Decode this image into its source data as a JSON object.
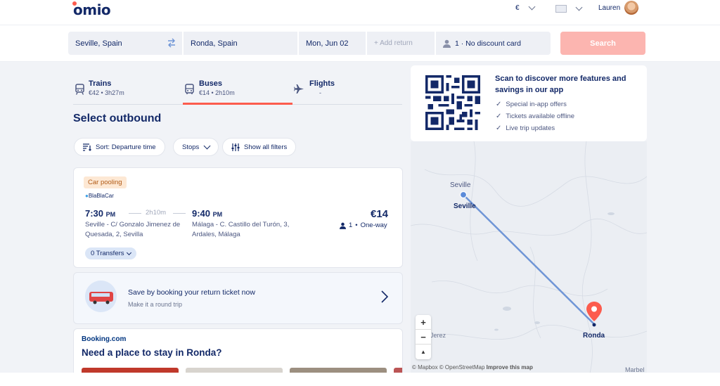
{
  "header": {
    "logo": "omio",
    "currency": "€",
    "user_name": "Lauren"
  },
  "search": {
    "origin": "Seville, Spain",
    "destination": "Ronda, Spain",
    "depart_date": "Mon, Jun 02",
    "return_placeholder": "+ Add return",
    "passengers": "1 · No discount card",
    "search_label": "Search"
  },
  "tabs": [
    {
      "label": "Trains",
      "sub": "€42 • 3h27m"
    },
    {
      "label": "Buses",
      "sub": "€14 • 2h10m"
    },
    {
      "label": "Flights",
      "sub": "-"
    }
  ],
  "heading": "Select outbound",
  "filters": {
    "sort": "Sort: Departure time",
    "stops": "Stops",
    "all": "Show all filters"
  },
  "result": {
    "badge": "Car pooling",
    "operator": "BlaBlaCar",
    "depart_time": "7:30",
    "depart_ampm": "PM",
    "duration": "2h10m",
    "arrive_time": "9:40",
    "arrive_ampm": "PM",
    "depart_station_1": "Seville - C/ Gonzalo Jimenez de",
    "depart_station_2": "Quesada, 2, Sevilla",
    "arrive_station_1": "Málaga - C. Castillo del Turón, 3,",
    "arrive_station_2": "Ardales, Málaga",
    "price": "€14",
    "passengers": "1",
    "trip_type": "One-way",
    "transfers": "0 Transfers"
  },
  "return_promo": {
    "title": "Save by booking your return ticket now",
    "subtitle": "Make it a round trip"
  },
  "booking": {
    "brand": "Booking.com",
    "title": "Need a place to stay in Ronda?"
  },
  "app_promo": {
    "title": "Scan to discover more features and savings in our app",
    "items": [
      "Special in-app offers",
      "Tickets available offline",
      "Live trip updates"
    ]
  },
  "map": {
    "origin_label": "Seville",
    "origin_label_bold": "Seville",
    "destination_label": "Ronda",
    "jerez_label": "Jerez",
    "marbel_label": "Marbel",
    "attribution": "© Mapbox © OpenStreetMap",
    "improve": "Improve this map",
    "zoom_in": "+",
    "zoom_out": "−",
    "compass": "▲"
  },
  "colors": {
    "primary": "#132968",
    "accent": "#fc5c4e",
    "search_button": "#fcb5b0",
    "route": "#6f95d6"
  }
}
